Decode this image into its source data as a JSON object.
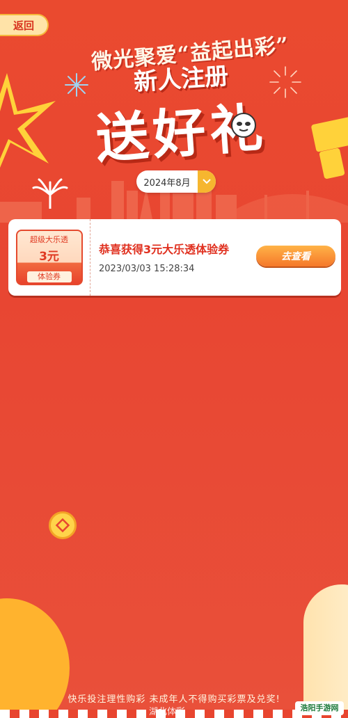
{
  "header": {
    "back_label": "返回"
  },
  "hero": {
    "line1": "微光聚爱“益起出彩”",
    "line2": "新人注册",
    "line3": "送好礼"
  },
  "filter": {
    "month_label": "2024年8月",
    "dropdown_icon": "chevron-down-icon"
  },
  "records": [
    {
      "ticket_top": "超级大乐透",
      "ticket_amount": "3元",
      "ticket_tag": "体验券",
      "title": "恭喜获得3元大乐透体验券",
      "time": "2023/03/03  15:28:34",
      "button_label": "去查看"
    }
  ],
  "footer": {
    "notice": "快乐投注理性购彩 未成年人不得购买彩票及兑奖!",
    "watermark": "湖北体彩",
    "logo_text": "浩阳手游网"
  },
  "colors": {
    "background": "#e8452f",
    "accent_yellow": "#f6b62f",
    "title_red": "#e0301f"
  }
}
